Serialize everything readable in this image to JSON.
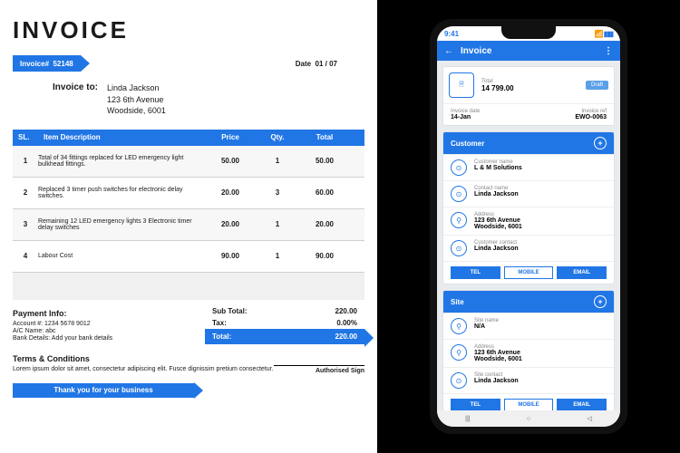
{
  "invoice": {
    "title": "INVOICE",
    "number_label": "Invoice#",
    "number": "52148",
    "date_label": "Date",
    "date": "01 / 07",
    "to_label": "Invoice to:",
    "to_name": "Linda Jackson",
    "to_addr1": "123 6th Avenue",
    "to_addr2": "Woodside, 6001",
    "cols": {
      "sl": "SL.",
      "desc": "Item Description",
      "price": "Price",
      "qty": "Qty.",
      "total": "Total"
    },
    "items": [
      {
        "sl": "1",
        "desc": "Total of 34 fittings replaced for LED emergency light bulkhead fittings.",
        "price": "50.00",
        "qty": "1",
        "total": "50.00"
      },
      {
        "sl": "2",
        "desc": "Replaced 3 timer push switches for electronic delay switches.",
        "price": "20.00",
        "qty": "3",
        "total": "60.00"
      },
      {
        "sl": "3",
        "desc": "Remaining 12 LED emergency lights\n3 Electronic timer delay switches",
        "price": "20.00",
        "qty": "1",
        "total": "20.00"
      },
      {
        "sl": "4",
        "desc": "Labour Cost",
        "price": "90.00",
        "qty": "1",
        "total": "90.00"
      }
    ],
    "subtotal_label": "Sub Total:",
    "subtotal": "220.00",
    "tax_label": "Tax:",
    "tax": "0.00%",
    "total_label": "Total:",
    "total": "220.00",
    "payment_header": "Payment Info:",
    "payment_account": "Account #:    1234 5678 9012",
    "payment_acname": "A/C Name:    abc",
    "payment_bank": "Bank Details:    Add your bank details",
    "terms_header": "Terms & Conditions",
    "terms_text": "Lorem ipsum dolor sit amet, consectetur adipiscing elit. Fusce dignissim pretium consectetur.",
    "sign_label": "Authorised Sign",
    "thanks": "Thank you for your business"
  },
  "phone": {
    "time": "9:41",
    "app_title": "Invoice",
    "total_label": "Total",
    "total_value": "14 799.00",
    "draft": "Draft",
    "date_label": "Invoice date",
    "date_value": "14-Jan",
    "ref_label": "Invoice ref",
    "ref_value": "EWO-0063",
    "customer_header": "Customer",
    "cust_name_label": "Customer name",
    "cust_name": "L & M Solutions",
    "contact_label": "Contact name",
    "contact_name": "Linda Jackson",
    "addr_label": "Address",
    "addr": "123 6th Avenue\nWoodside, 6001",
    "cust_contact_label": "Customer contact",
    "cust_contact": "Linda Jackson",
    "btn_tel": "TEL",
    "btn_mobile": "MOBILE",
    "btn_email": "EMAIL",
    "site_header": "Site",
    "site_name_label": "Site name",
    "site_name": "N/A",
    "site_addr_label": "Address",
    "site_addr": "123 6th Avenue\nWoodside, 6001",
    "site_contact_label": "Site contact",
    "site_contact": "Linda Jackson"
  }
}
